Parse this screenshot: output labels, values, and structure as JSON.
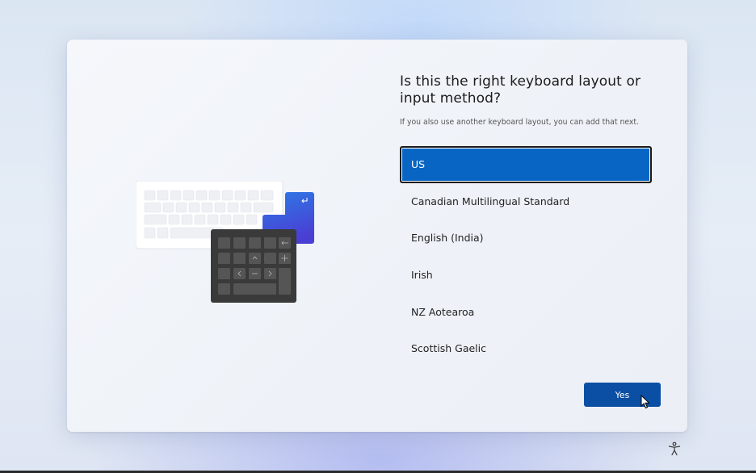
{
  "setup": {
    "heading": "Is this the right keyboard layout or input method?",
    "subtext": "If you also use another keyboard layout, you can add that next.",
    "layouts": [
      {
        "label": "US",
        "selected": true
      },
      {
        "label": "Canadian Multilingual Standard",
        "selected": false
      },
      {
        "label": "English (India)",
        "selected": false
      },
      {
        "label": "Irish",
        "selected": false
      },
      {
        "label": "NZ Aotearoa",
        "selected": false
      },
      {
        "label": "Scottish Gaelic",
        "selected": false
      }
    ],
    "yes_label": "Yes"
  },
  "colors": {
    "accent": "#0865c4",
    "button": "#0a4fa3",
    "illustration_accent": "#3a5fd8"
  },
  "icons": {
    "illustration": "keyboard-illustration",
    "pointer": "mouse-pointer-icon",
    "accessibility": "accessibility-icon"
  }
}
